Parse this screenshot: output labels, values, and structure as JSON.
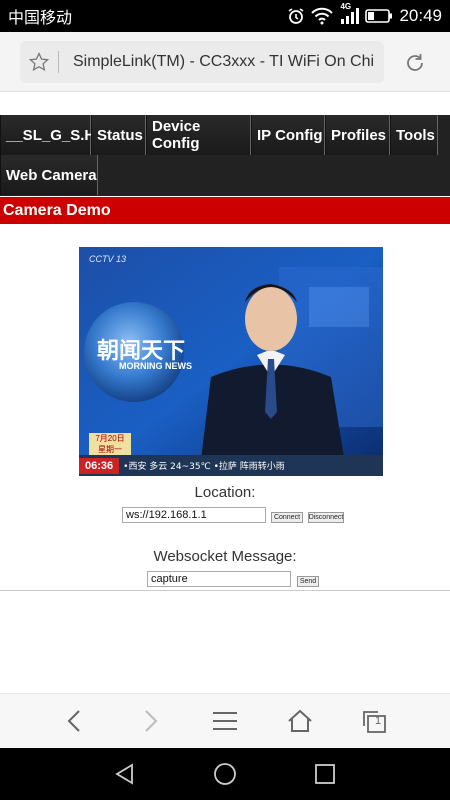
{
  "status_bar": {
    "carrier": "中国移动",
    "network": "4G",
    "time": "20:49",
    "icons": [
      "alarm-icon",
      "wifi-icon",
      "signal-icon",
      "battery-icon"
    ]
  },
  "browser": {
    "url_title": "SimpleLink(TM) - CC3xxx - TI WiFi On Chi",
    "icons": [
      "star-icon",
      "reload-icon"
    ]
  },
  "nav": {
    "items": [
      {
        "label": "__SL_G_S.H"
      },
      {
        "label": "Status"
      },
      {
        "label": "Device Config"
      },
      {
        "label": "IP Config"
      },
      {
        "label": "Profiles"
      },
      {
        "label": "Tools"
      },
      {
        "label": "Web Camera"
      }
    ]
  },
  "camera": {
    "header": "Camera Demo",
    "frame": {
      "channel_logo": "CCTV 13",
      "show_title": "朝闻天下",
      "show_subtitle": "MORNING NEWS",
      "date": "7月20日",
      "weekday": "星期一",
      "clock": "06:36",
      "ticker": "•西安 多云 24~35℃ •拉萨 阵雨转小雨"
    }
  },
  "location": {
    "label": "Location:",
    "value": "ws://192.168.1.1",
    "connect_label": "Connect",
    "disconnect_label": "Disconnect"
  },
  "websocket": {
    "label": "Websocket Message:",
    "value": "capture",
    "send_label": "Send"
  },
  "toolbar": {
    "tab_count": "1",
    "icons": [
      "back-icon",
      "forward-icon",
      "menu-icon",
      "home-icon",
      "tabs-icon"
    ]
  },
  "android_nav": {
    "icons": [
      "back-triangle-icon",
      "home-circle-icon",
      "recents-square-icon"
    ]
  }
}
